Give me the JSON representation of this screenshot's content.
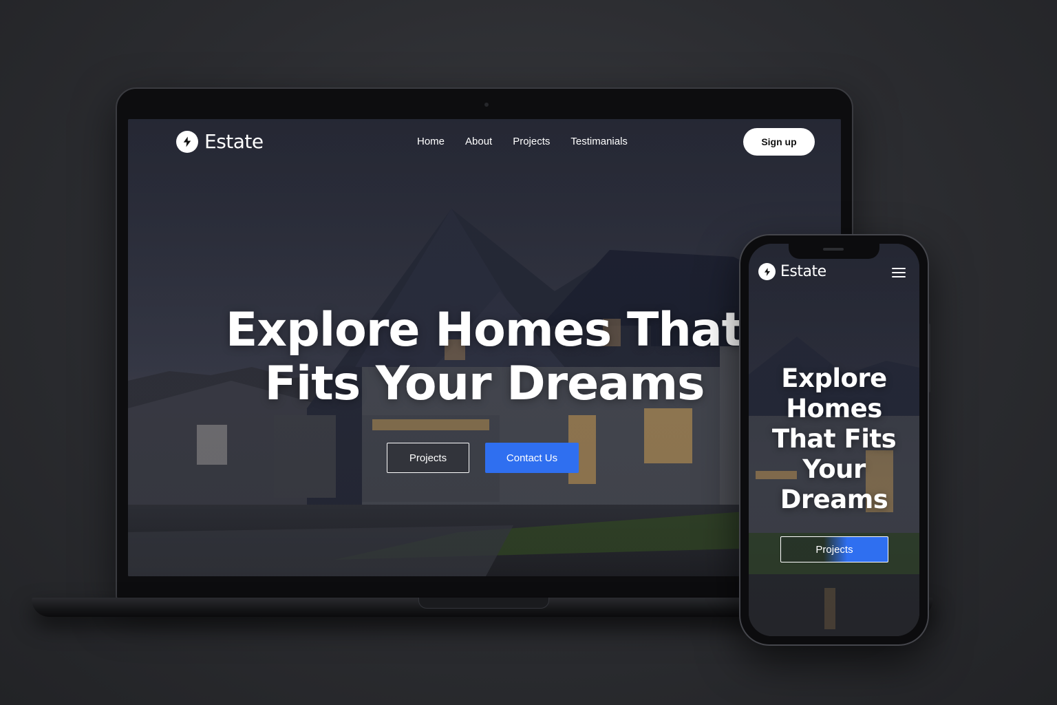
{
  "brand": {
    "name": "Estate",
    "icon": "lightning-bolt-icon"
  },
  "nav": {
    "links": [
      "Home",
      "About",
      "Projects",
      "Testimanials"
    ],
    "signup_label": "Sign up"
  },
  "hero": {
    "title_line1": "Explore Homes That",
    "title_line2": "Fits Your Dreams",
    "projects_label": "Projects",
    "contact_label": "Contact Us"
  },
  "mobile": {
    "brand_name": "Estate",
    "menu_icon": "hamburger-menu-icon",
    "title_lines": [
      "Explore",
      "Homes",
      "That Fits",
      "Your",
      "Dreams"
    ],
    "projects_label": "Projects"
  },
  "colors": {
    "accent": "#2f6ff0",
    "background": "#2b2c30",
    "text": "#ffffff"
  }
}
